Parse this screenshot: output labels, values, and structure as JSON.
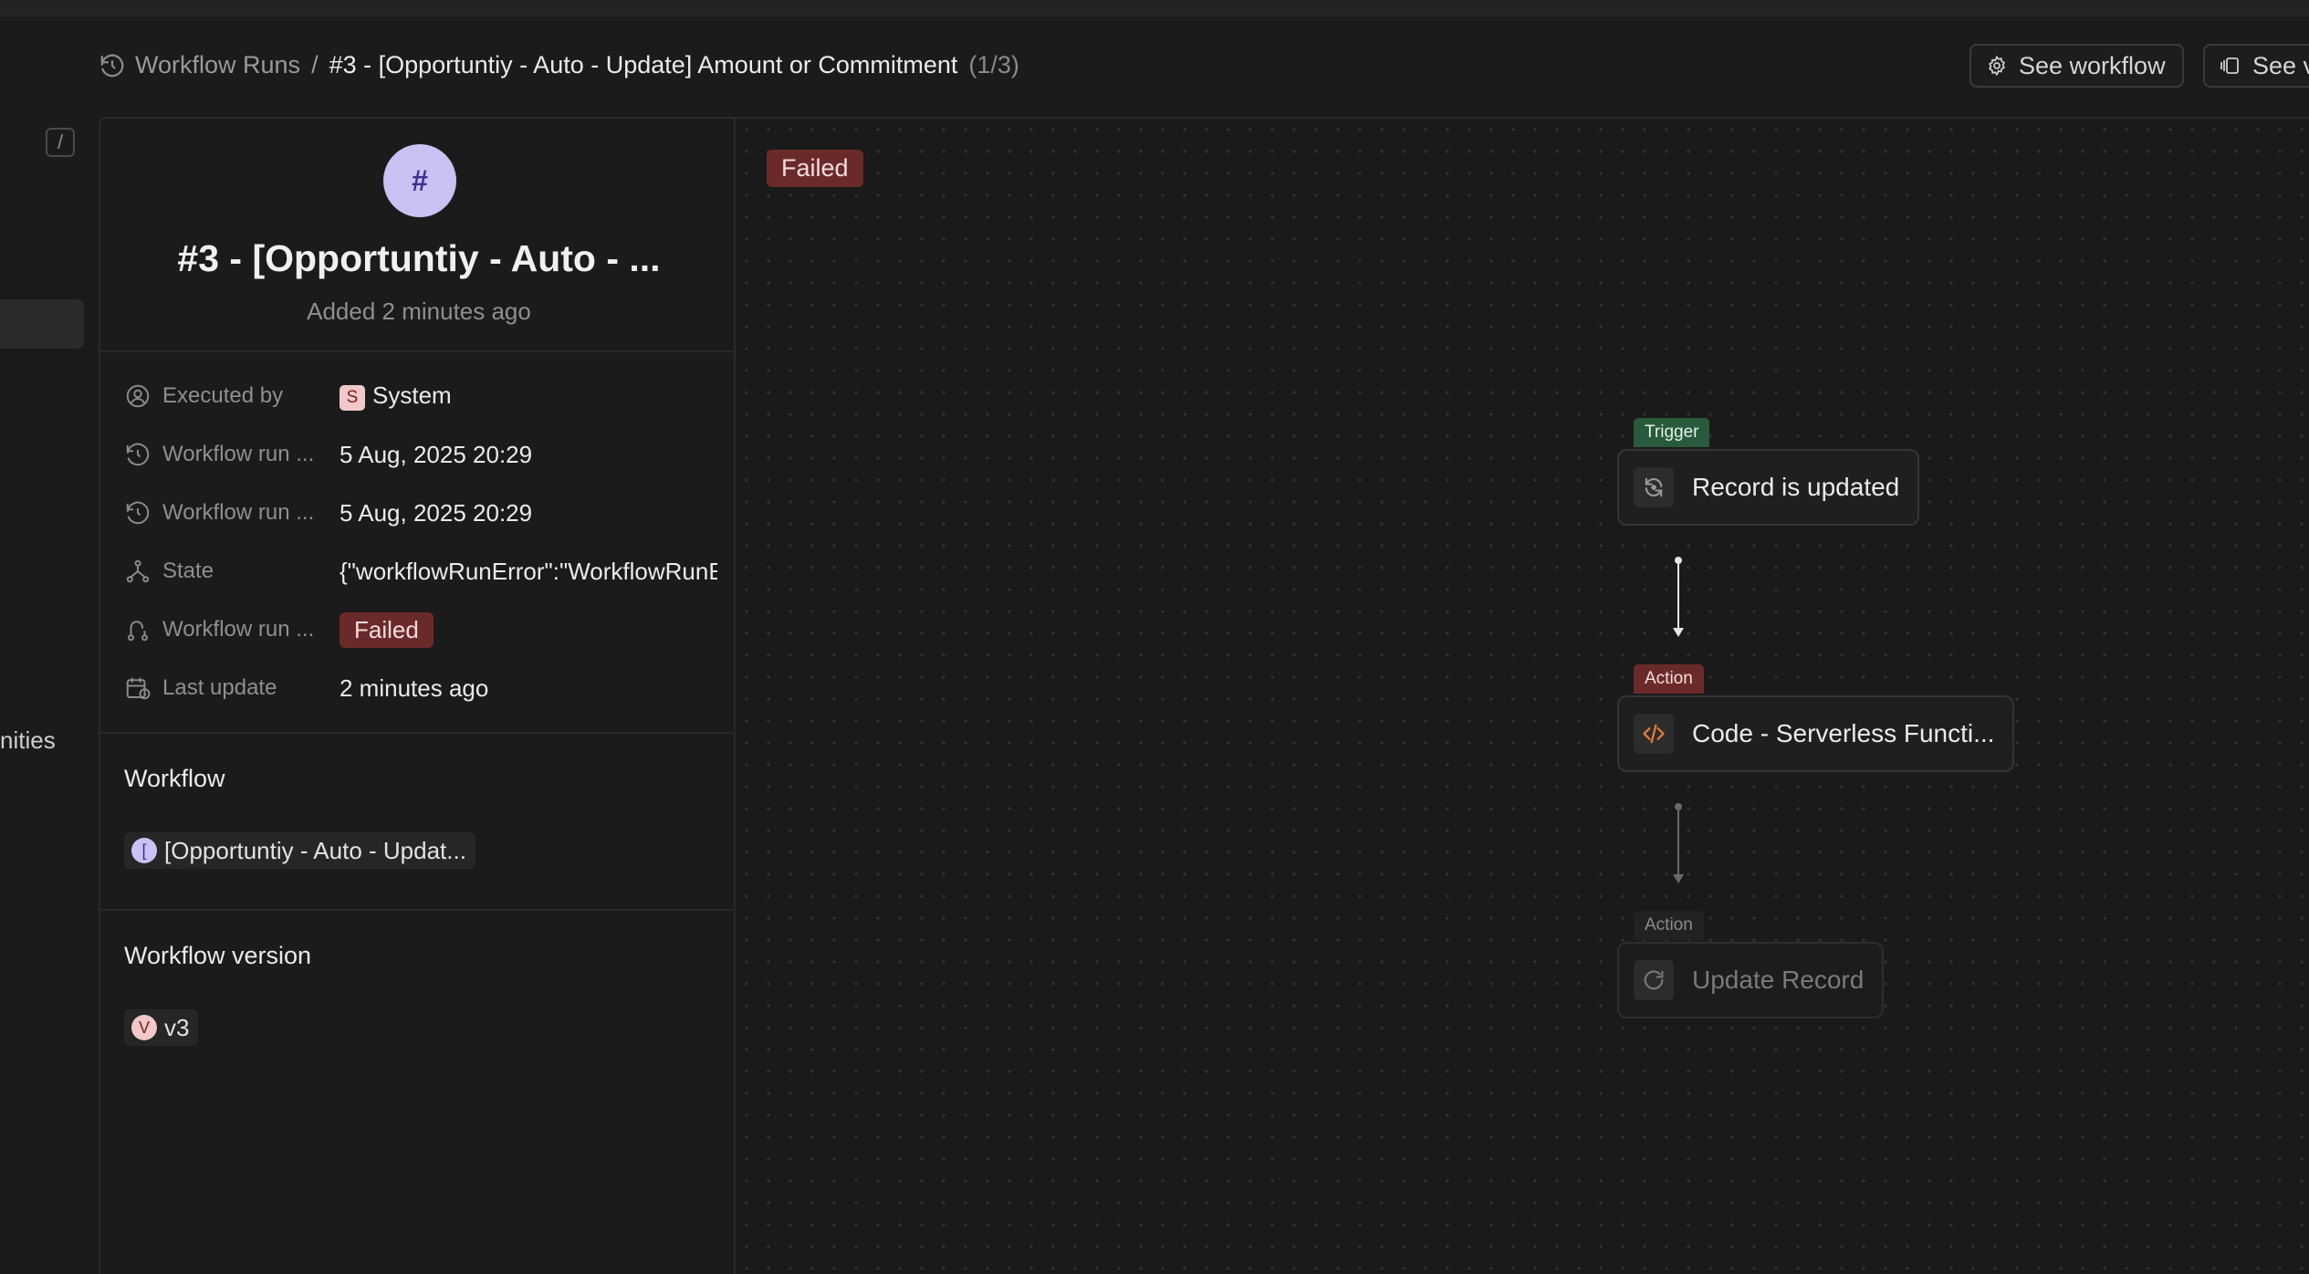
{
  "header": {
    "breadcrumb_parent": "Workflow Runs",
    "breadcrumb_separator": "/",
    "breadcrumb_current": "#3 - [Opportuntiy - Auto - Update] Amount or Commitment",
    "breadcrumb_count": "(1/3)",
    "see_workflow_label": "See workflow",
    "see_versions_label": "See v"
  },
  "sidebar": {
    "toggle_label": "/",
    "truncated_item_label": "nities"
  },
  "record": {
    "avatar_letter": "#",
    "title": "#3 - [Opportuntiy - Auto - ...",
    "subtitle": "Added 2 minutes ago",
    "fields": [
      {
        "label": "Executed by",
        "value": "System",
        "avatar": "S",
        "icon": "user-circle-icon"
      },
      {
        "label": "Workflow run ...",
        "value": "5 Aug, 2025 20:29",
        "icon": "history-icon"
      },
      {
        "label": "Workflow run ...",
        "value": "5 Aug, 2025 20:29",
        "icon": "history-icon"
      },
      {
        "label": "State",
        "value": "{\"workflowRunError\":\"WorkflowRunError",
        "icon": "hierarchy-icon"
      },
      {
        "label": "Workflow run ...",
        "value": "Failed",
        "icon": "route-icon"
      },
      {
        "label": "Last update",
        "value": "2 minutes ago",
        "icon": "calendar-clock-icon"
      }
    ],
    "workflow_section_title": "Workflow",
    "workflow_chip_letter": "[",
    "workflow_chip_label": "[Opportuntiy - Auto - Updat...",
    "version_section_title": "Workflow version",
    "version_chip_letter": "V",
    "version_chip_label": "v3"
  },
  "canvas": {
    "status": "Failed",
    "nodes": [
      {
        "tag": "Trigger",
        "label": "Record is updated",
        "icon": "refresh-dot-icon",
        "state": "success"
      },
      {
        "tag": "Action",
        "label": "Code - Serverless Functi...",
        "icon": "code-icon",
        "state": "failed"
      },
      {
        "tag": "Action",
        "label": "Update Record",
        "icon": "reload-icon",
        "state": "not-started"
      }
    ]
  },
  "colors": {
    "background": "#1b1b1b",
    "failed_badge": "#6b2a2a",
    "trigger_tag": "#2a5a3c",
    "avatar_purple": "#c9c2f2",
    "code_icon_orange": "#e07a3c"
  }
}
